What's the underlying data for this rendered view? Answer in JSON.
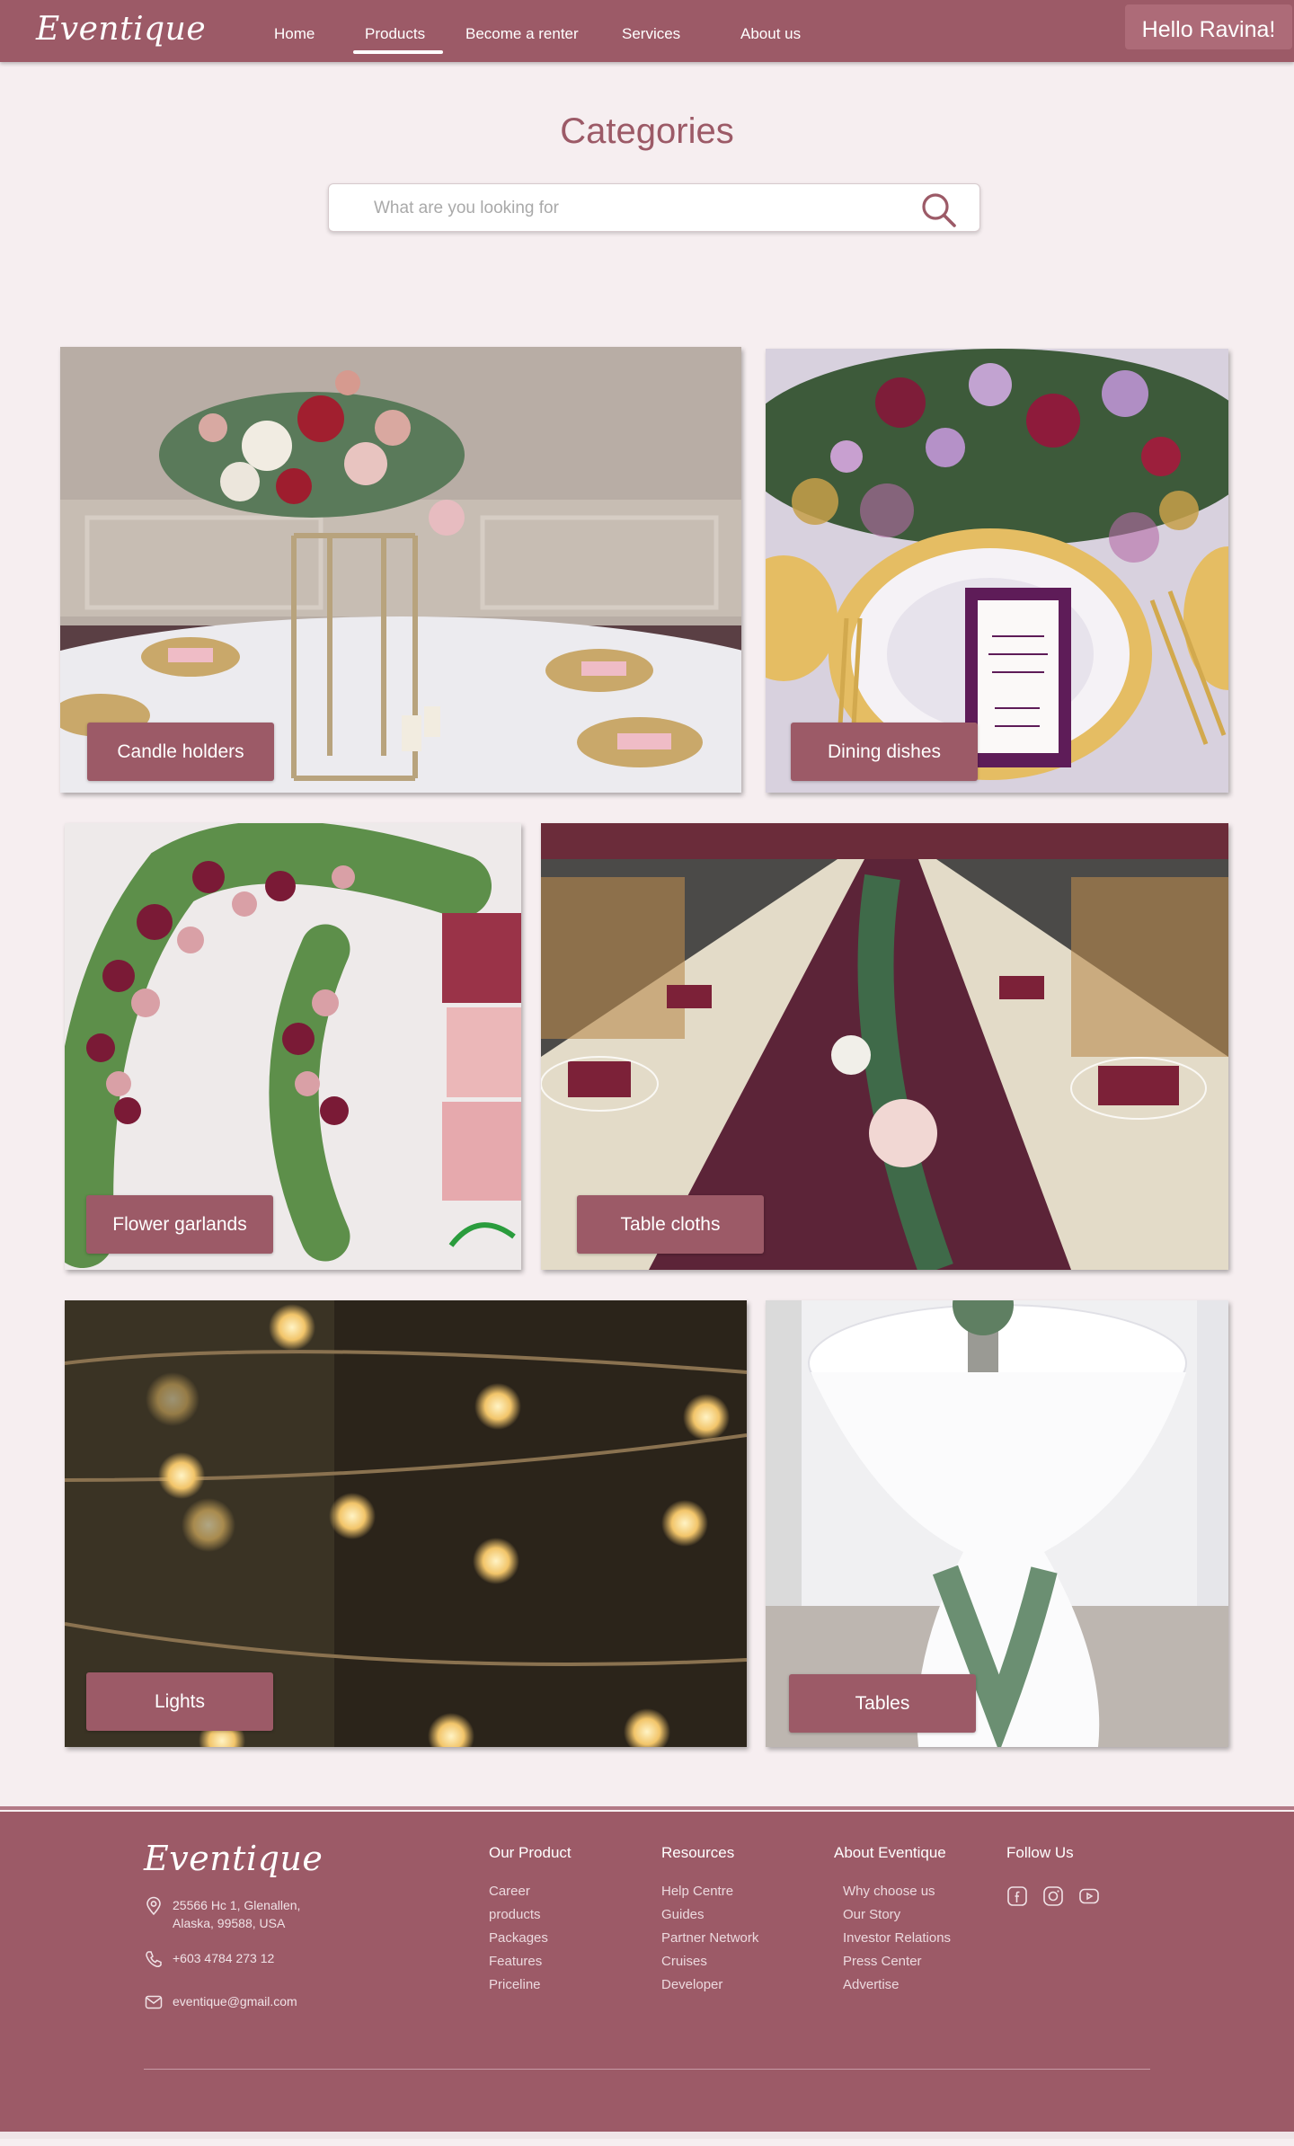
{
  "header": {
    "logo": "Eventique",
    "nav": [
      {
        "label": "Home"
      },
      {
        "label": "Products"
      },
      {
        "label": "Become a renter"
      },
      {
        "label": "Services"
      },
      {
        "label": "About us"
      }
    ],
    "active_nav": "Products",
    "greeting": "Hello Ravina!"
  },
  "main": {
    "title": "Categories",
    "search": {
      "placeholder": "What are you looking for",
      "value": "",
      "icon": "search-icon"
    },
    "categories": [
      {
        "label": "Candle holders"
      },
      {
        "label": "Dining dishes"
      },
      {
        "label": "Flower garlands"
      },
      {
        "label": "Table cloths"
      },
      {
        "label": "Lights"
      },
      {
        "label": "Tables"
      }
    ]
  },
  "footer": {
    "logo": "Eventique",
    "address_line1": "25566 Hc 1, Glenallen,",
    "address_line2": "Alaska, 99588, USA",
    "phone": "+603 4784 273 12",
    "email": "eventique@gmail.com",
    "columns": [
      {
        "title": "Our Product",
        "links": [
          "Career",
          "products",
          "Packages",
          "Features",
          "Priceline"
        ]
      },
      {
        "title": "Resources",
        "links": [
          "Help Centre",
          "Guides",
          "Partner Network",
          "Cruises",
          "Developer"
        ]
      },
      {
        "title": "About Eventique",
        "links": [
          "Why choose us",
          "Our Story",
          "Investor Relations",
          "Press Center",
          "Advertise"
        ]
      },
      {
        "title": "Follow Us",
        "links": []
      }
    ],
    "social_icons": [
      "facebook-icon",
      "instagram-icon",
      "youtube-icon"
    ]
  },
  "colors": {
    "brand": "#9c5a67",
    "background": "#f6eef0",
    "text_light": "#ffffff"
  }
}
